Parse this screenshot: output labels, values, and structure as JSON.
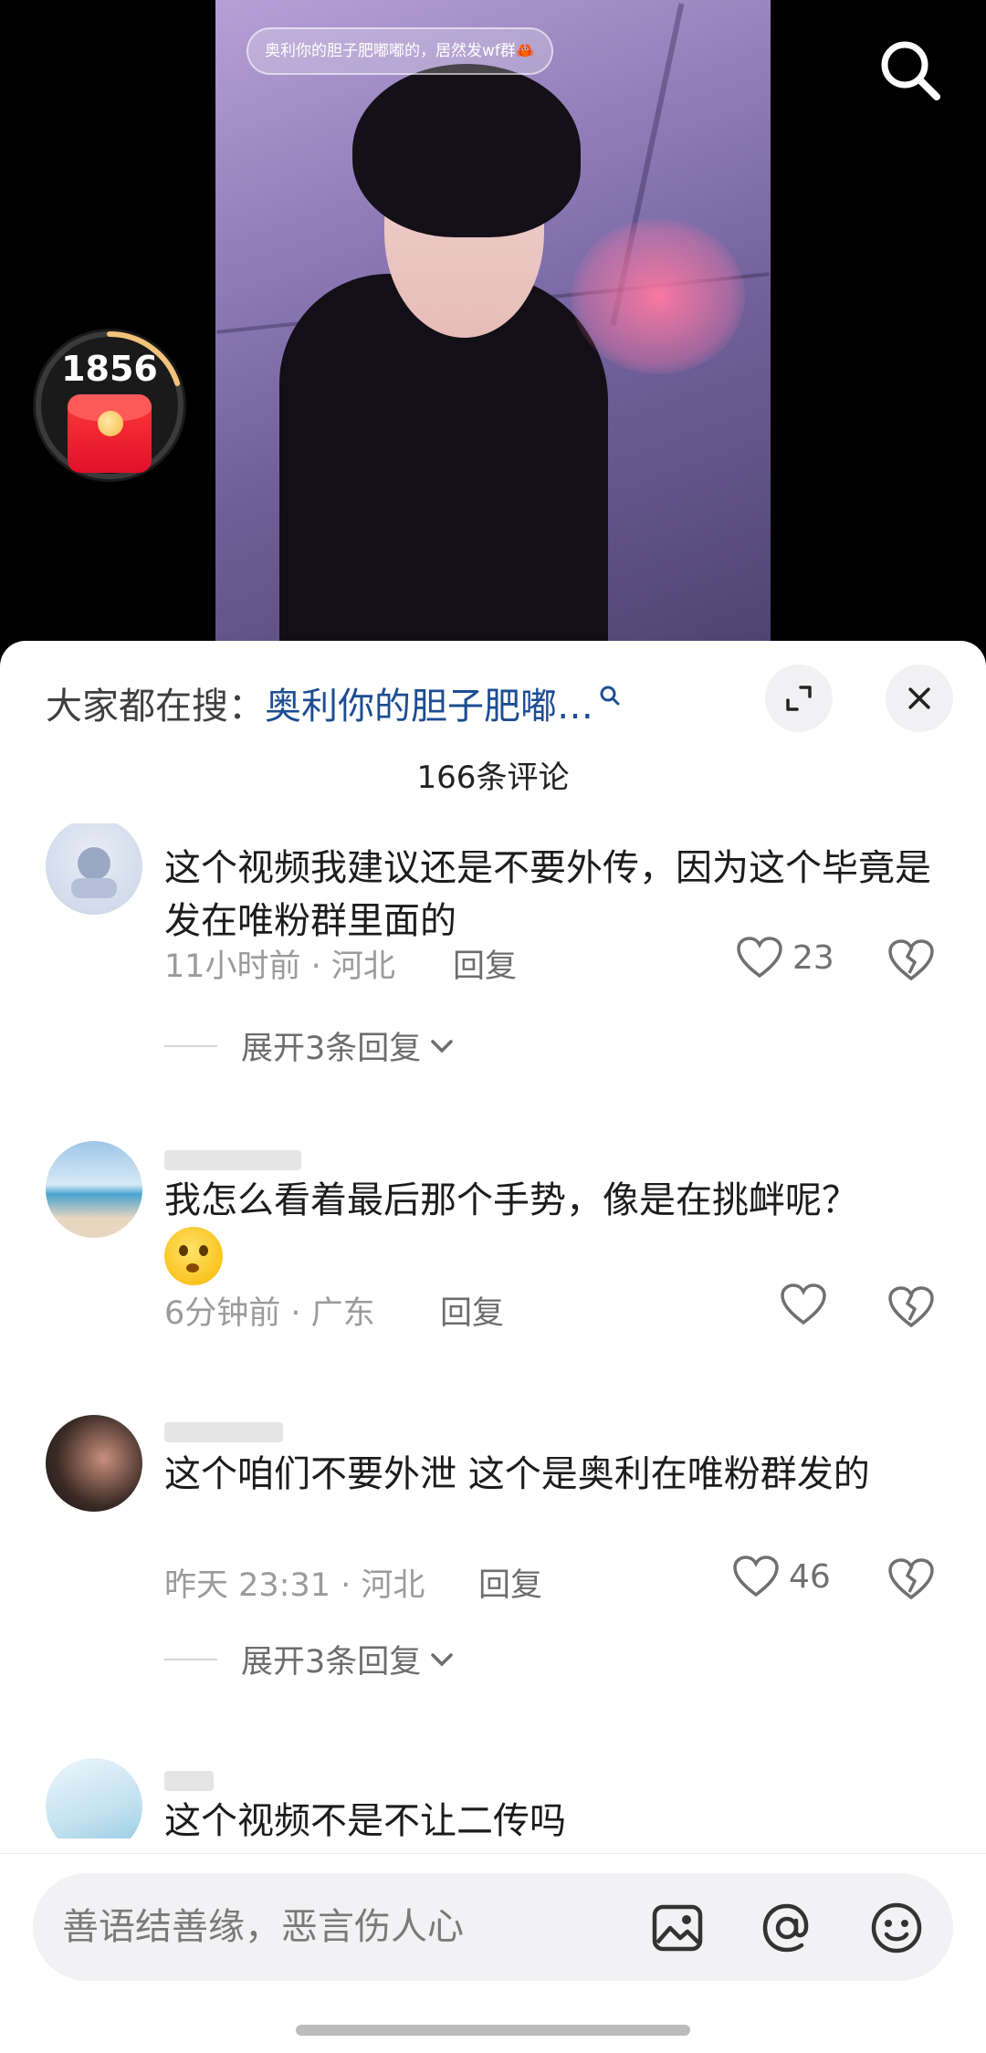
{
  "video": {
    "caption": "奥利你的胆子肥嘟嘟的，居然发wf群🦀",
    "search_icon": "search-icon",
    "redpacket_count": "1856",
    "redpacket_progress": 0.2
  },
  "sheet": {
    "hot_search_prefix": "大家都在搜：",
    "hot_search_term": "奥利你的胆子肥嘟…",
    "comment_count": "166条评论"
  },
  "comments": [
    {
      "text": "这个视频我建议还是不要外传，因为这个毕竟是发在唯粉群里面的",
      "time_location": "11小时前 · 河北",
      "reply_label": "回复",
      "likes": "23",
      "expand_label": "展开3条回复"
    },
    {
      "text": "我怎么看着最后那个手势，像是在挑衅呢？",
      "time_location": "6分钟前 · 广东",
      "reply_label": "回复",
      "likes": ""
    },
    {
      "text": "这个咱们不要外泄 这个是奥利在唯粉群发的",
      "time_location": "昨天 23:31 · 河北",
      "reply_label": "回复",
      "likes": "46",
      "expand_label": "展开3条回复"
    },
    {
      "text": "这个视频不是不让二传吗"
    }
  ],
  "input": {
    "placeholder": "善语结善缘，恶言伤人心",
    "icons": [
      "image-icon",
      "at-icon",
      "emoji-icon"
    ]
  }
}
